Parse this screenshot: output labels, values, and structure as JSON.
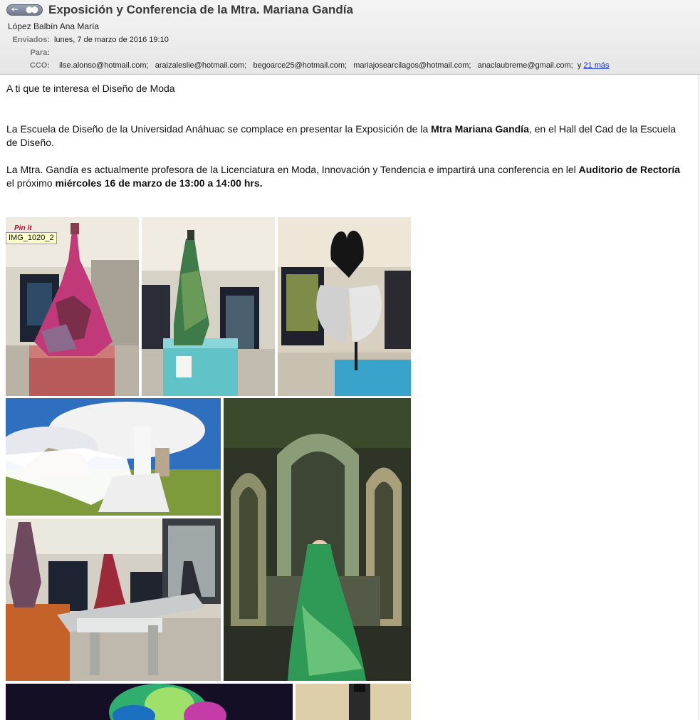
{
  "header": {
    "subject": "Exposición y Conferencia de la Mtra. Mariana Gandía",
    "from": "López Balbín Ana María",
    "sent_label": "Enviados:",
    "sent_value": "lunes, 7 de marzo de 2016 19:10",
    "to_label": "Para:",
    "to_value": "",
    "cco_label": "CCO:",
    "cco": [
      "ilse.alonso@hotmail.com;",
      "araizaleslie@hotmail.com;",
      "begoarce25@hotmail.com;",
      "mariajosearcilagos@hotmail.com;",
      "anaclaubreme@gmail.com;"
    ],
    "cco_more_prefix": "y",
    "cco_more_link": "21 más"
  },
  "body": {
    "intro": "A ti que te interesa el Diseño de Moda",
    "p1_a": "La Escuela de Diseño de la Universidad Anáhuac se complace en presentar la Exposición de la ",
    "p1_bold": "Mtra Mariana Gandía",
    "p1_b": ", en el Hall del Cad de la Escuela de Diseño.",
    "p2_a": "La Mtra. Gandía es actualmente profesora de la Licenciatura en Moda, Innovación y Tendencia e impartirá una conferencia en lel ",
    "p2_bold1": "Auditorio de Rectoría",
    "p2_b": " el próximo ",
    "p2_bold2": "miércoles 16 de marzo de 13:00 a 14:00 hrs."
  },
  "images": {
    "tooltip": "IMG_1020_2",
    "pin_label": "Pin it"
  },
  "colors": {
    "link": "#1a33cc",
    "header_label": "#777777",
    "tooltip_bg": "#ffffc8"
  }
}
